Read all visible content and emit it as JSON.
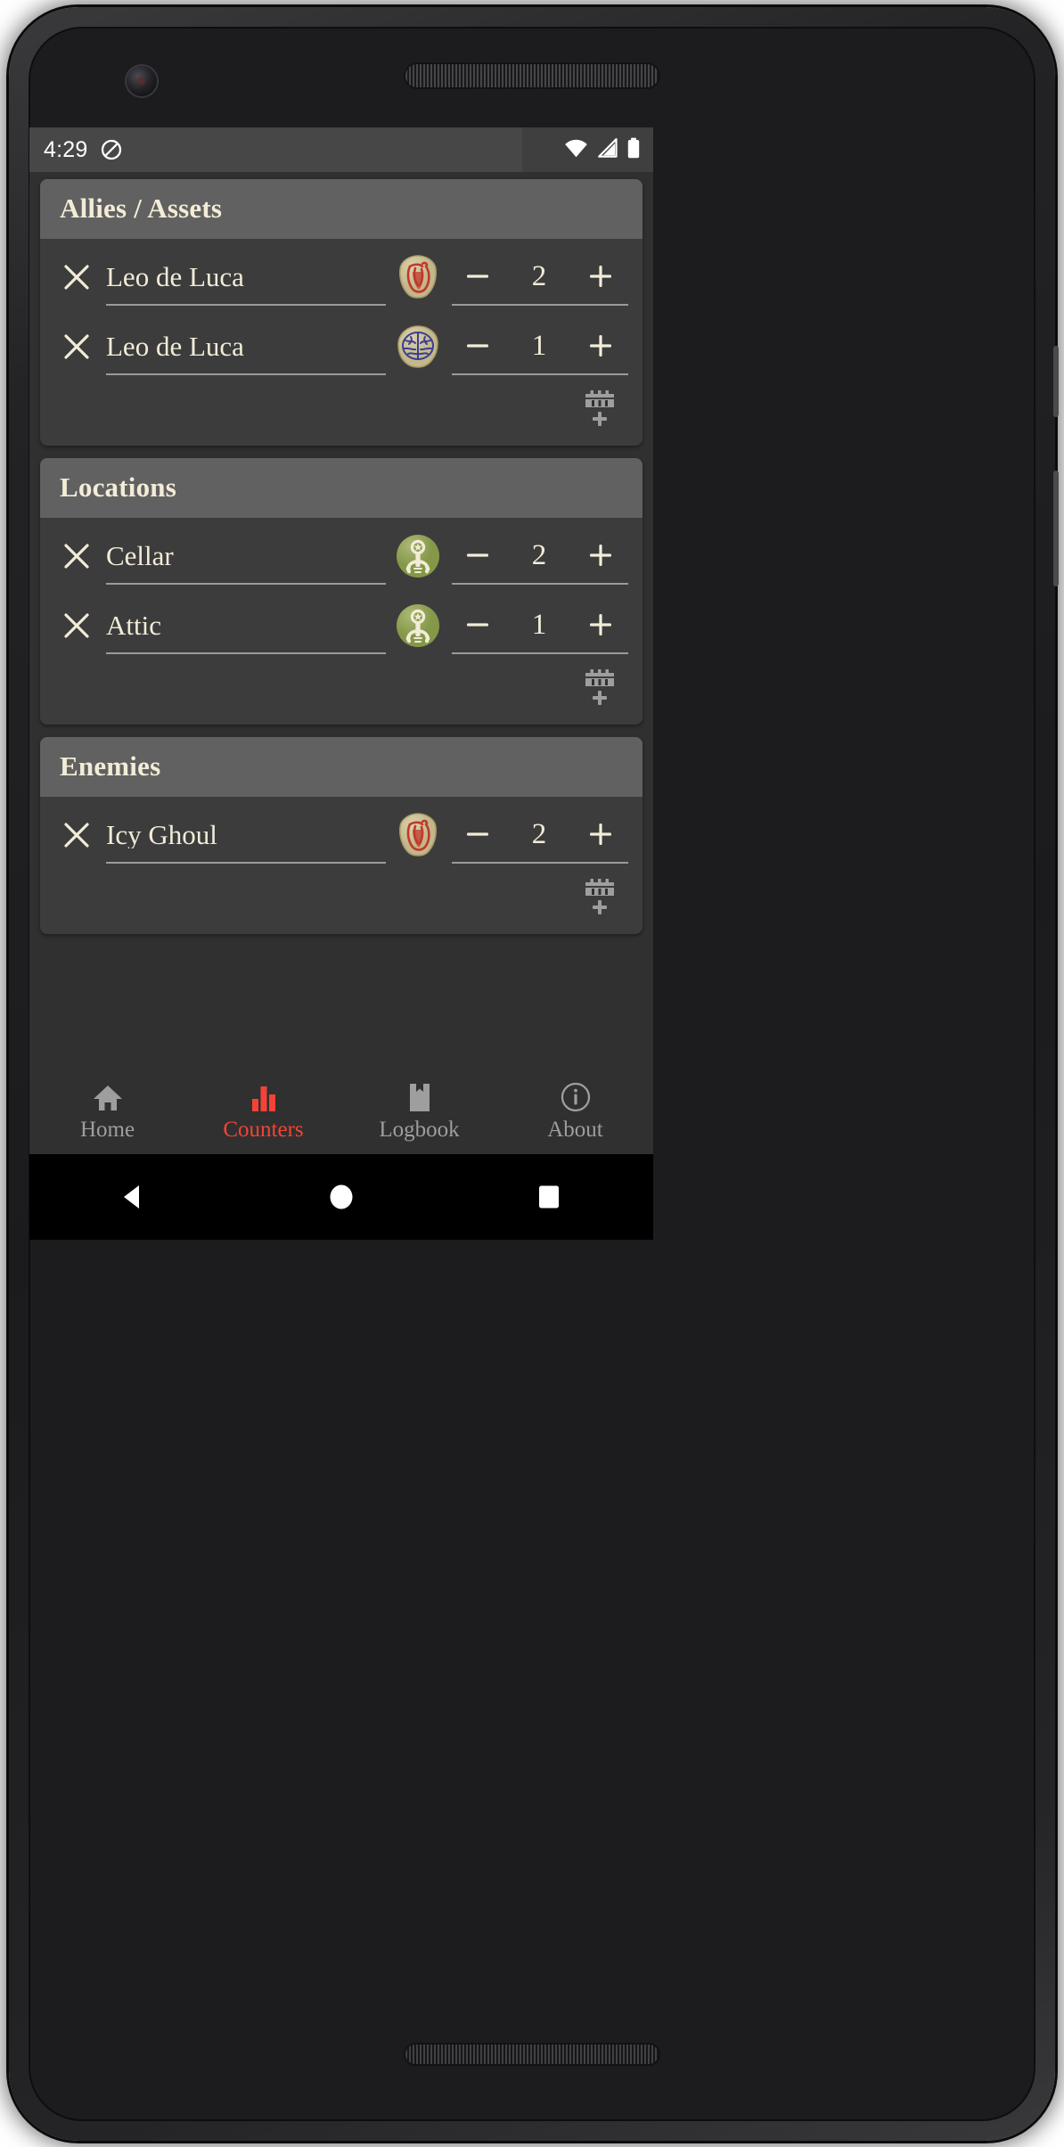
{
  "status_bar": {
    "time": "4:29",
    "dnd_icon": "do-not-disturb-icon",
    "wifi_icon": "wifi-icon",
    "signal_icon": "cellular-signal-icon",
    "battery_icon": "battery-full-icon"
  },
  "colors": {
    "screen_bg": "#303030",
    "card_bg": "#3c3c3c",
    "card_header_bg": "#616161",
    "text_cream": "#f2ecd8",
    "divider": "#9b9b9b",
    "accent_active": "#f44336",
    "nav_inactive": "#9e9e9e",
    "status_bar_bg": "#3f3f3f",
    "token_health_red": "#c0392b",
    "token_sanity_blue": "#3b3f8f",
    "token_parchment": "#cfc49a",
    "token_clue_green": "#8ea24f"
  },
  "sections": [
    {
      "title": "Allies / Assets",
      "add_row_label": "add-row",
      "rows": [
        {
          "name": "Leo de Luca",
          "token": "health-token",
          "value": "2",
          "minus": "−",
          "plus": "+",
          "remove": "✕"
        },
        {
          "name": "Leo de Luca",
          "token": "sanity-token",
          "value": "1",
          "minus": "−",
          "plus": "+",
          "remove": "✕"
        }
      ]
    },
    {
      "title": "Locations",
      "add_row_label": "add-row",
      "rows": [
        {
          "name": "Cellar",
          "token": "clue-token",
          "value": "2",
          "minus": "−",
          "plus": "+",
          "remove": "✕"
        },
        {
          "name": "Attic",
          "token": "clue-token",
          "value": "1",
          "minus": "−",
          "plus": "+",
          "remove": "✕"
        }
      ]
    },
    {
      "title": "Enemies",
      "add_row_label": "add-row",
      "rows": [
        {
          "name": "Icy Ghoul",
          "token": "health-token",
          "value": "2",
          "minus": "−",
          "plus": "+",
          "remove": "✕"
        }
      ]
    }
  ],
  "bottom_nav": {
    "items": [
      {
        "label": "Home",
        "icon": "home-icon",
        "active": false
      },
      {
        "label": "Counters",
        "icon": "bar-chart-icon",
        "active": true
      },
      {
        "label": "Logbook",
        "icon": "bookmark-icon",
        "active": false
      },
      {
        "label": "About",
        "icon": "info-circle-icon",
        "active": false
      }
    ]
  },
  "system_nav": {
    "back": "back-triangle-icon",
    "home": "home-circle-icon",
    "recents": "recents-square-icon"
  }
}
